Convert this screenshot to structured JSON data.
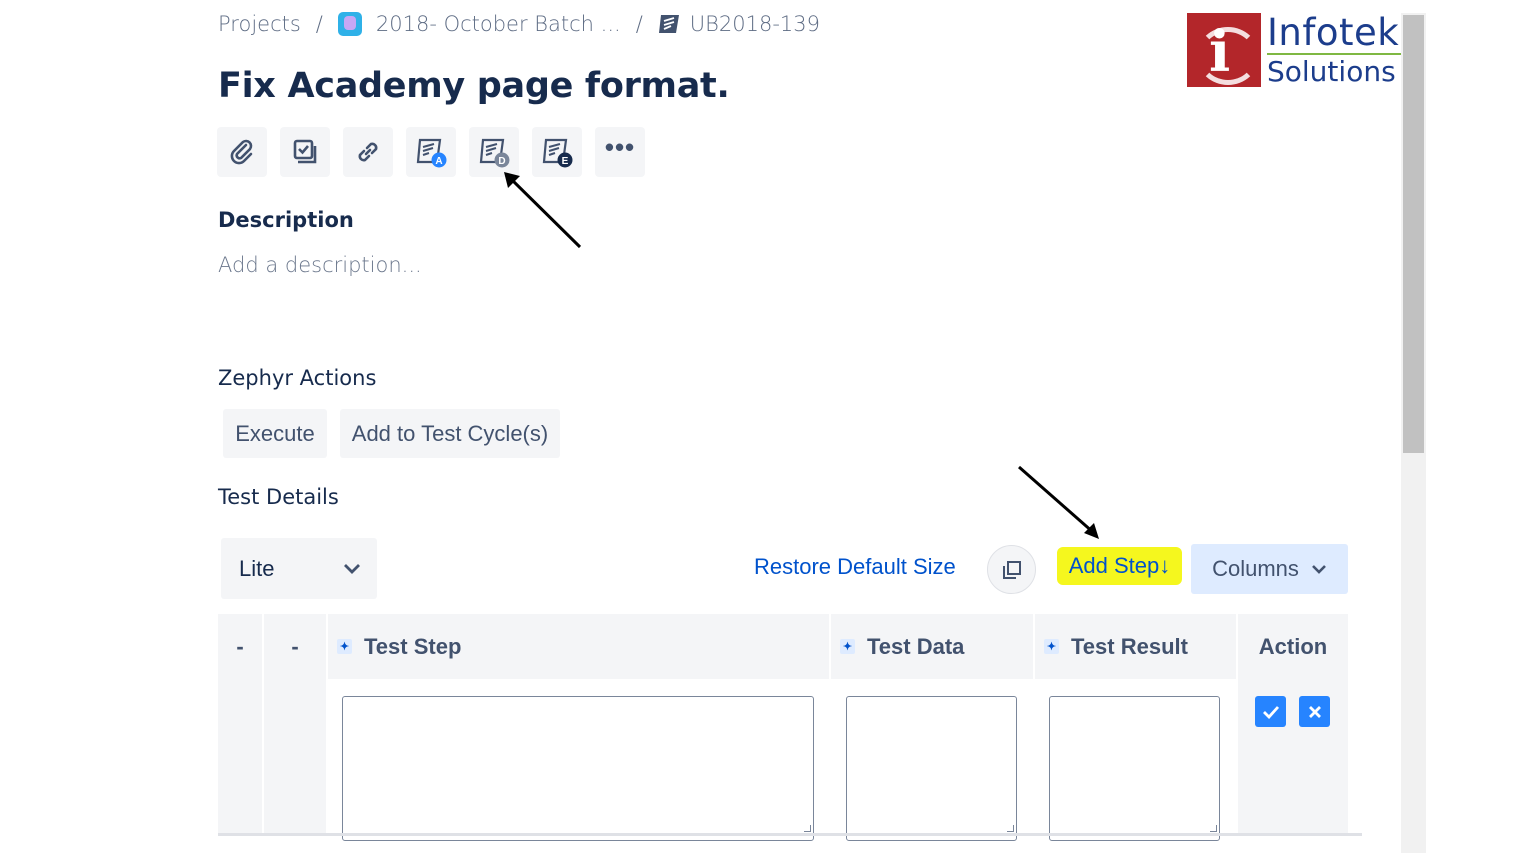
{
  "breadcrumb": {
    "root": "Projects",
    "project": "2018- October Batch ...",
    "issue": "UB2018-139",
    "separator": "/"
  },
  "logo": {
    "line1": "Infotek",
    "line2": "Solutions",
    "mark_letter": "i",
    "brand_color": "#b3262a",
    "text_color": "#1c3d8c"
  },
  "issue": {
    "title": "Fix Academy page format."
  },
  "toolbar": {
    "buttons": [
      {
        "name": "attach-icon"
      },
      {
        "name": "subtask-icon"
      },
      {
        "name": "link-icon"
      },
      {
        "name": "automation-a-icon",
        "badge": "A"
      },
      {
        "name": "automation-d-icon",
        "badge": "D"
      },
      {
        "name": "automation-e-icon",
        "badge": "E"
      }
    ],
    "more_label": "•••"
  },
  "description": {
    "label": "Description",
    "placeholder": "Add a description..."
  },
  "zephyr": {
    "label": "Zephyr Actions",
    "execute_label": "Execute",
    "add_cycle_label": "Add to Test Cycle(s)"
  },
  "test_details": {
    "label": "Test Details",
    "mode_select": "Lite",
    "restore_label": "Restore Default Size",
    "add_step_label": "Add Step↓",
    "columns_label": "Columns",
    "highlight_color": "#f5f71e",
    "link_color": "#0052cc"
  },
  "table": {
    "headers": [
      "-",
      "-",
      "Test Step",
      "Test Data",
      "Test Result",
      "Action"
    ],
    "pin_glyph": "📌"
  }
}
